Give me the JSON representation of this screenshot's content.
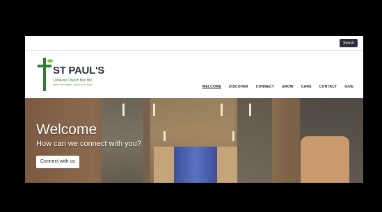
{
  "topbar": {
    "search_label": "Search"
  },
  "logo": {
    "name": "ST PAUL'S",
    "subtitle": "Lutheran Church Box Hill",
    "tagline": "faith to be shared, grace to be lived"
  },
  "nav": {
    "items": [
      {
        "label": "WELCOME"
      },
      {
        "label": "DISCOVER"
      },
      {
        "label": "CONNECT"
      },
      {
        "label": "GROW"
      },
      {
        "label": "CARE"
      },
      {
        "label": "CONTACT"
      },
      {
        "label": "GIVE"
      }
    ]
  },
  "hero": {
    "title": "Welcome",
    "subtitle": "How can we connect with you?",
    "button_label": "Connect with us"
  },
  "colors": {
    "brand_green": "#2e7d32",
    "leaf_green": "#8bc34a",
    "search_bg": "#2a2f3a"
  }
}
